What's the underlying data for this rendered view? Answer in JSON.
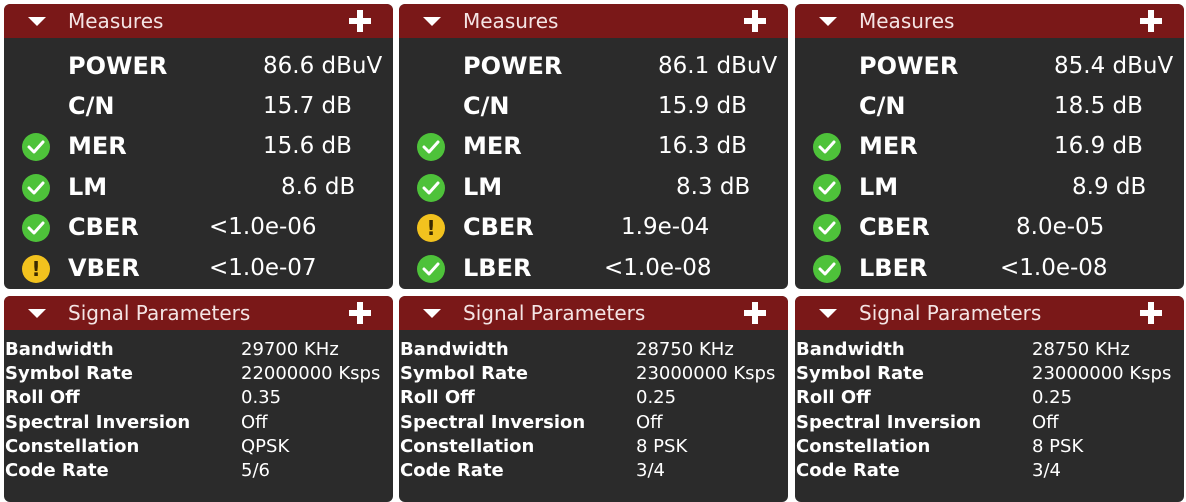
{
  "panels": [
    {
      "measures": {
        "title": "Measures",
        "items": [
          {
            "name": "POWER",
            "value": "86.6 dBuV",
            "status": "none"
          },
          {
            "name": "C/N",
            "value": "15.7 dB",
            "status": "none"
          },
          {
            "name": "MER",
            "value": "15.6 dB",
            "status": "ok"
          },
          {
            "name": "LM",
            "value": "8.6 dB",
            "status": "ok"
          },
          {
            "name": "CBER",
            "value": "<1.0e-06",
            "status": "ok"
          },
          {
            "name": "VBER",
            "value": "<1.0e-07",
            "status": "warning"
          }
        ]
      },
      "signal": {
        "title": "Signal Parameters",
        "items": [
          {
            "name": "Bandwidth",
            "value": "29700 KHz"
          },
          {
            "name": "Symbol Rate",
            "value": "22000000 Ksps"
          },
          {
            "name": "Roll Off",
            "value": "0.35"
          },
          {
            "name": "Spectral Inversion",
            "value": "Off"
          },
          {
            "name": "Constellation",
            "value": "QPSK"
          },
          {
            "name": "Code Rate",
            "value": "5/6"
          }
        ]
      }
    },
    {
      "measures": {
        "title": "Measures",
        "items": [
          {
            "name": "POWER",
            "value": "86.1 dBuV",
            "status": "none"
          },
          {
            "name": "C/N",
            "value": "15.9 dB",
            "status": "none"
          },
          {
            "name": "MER",
            "value": "16.3 dB",
            "status": "ok"
          },
          {
            "name": "LM",
            "value": "8.3 dB",
            "status": "ok"
          },
          {
            "name": "CBER",
            "value": "1.9e-04",
            "status": "warning"
          },
          {
            "name": "LBER",
            "value": "<1.0e-08",
            "status": "ok"
          }
        ]
      },
      "signal": {
        "title": "Signal Parameters",
        "items": [
          {
            "name": "Bandwidth",
            "value": "28750 KHz"
          },
          {
            "name": "Symbol Rate",
            "value": "23000000 Ksps"
          },
          {
            "name": "Roll Off",
            "value": "0.25"
          },
          {
            "name": "Spectral Inversion",
            "value": "Off"
          },
          {
            "name": "Constellation",
            "value": "8 PSK"
          },
          {
            "name": "Code Rate",
            "value": "3/4"
          }
        ]
      }
    },
    {
      "measures": {
        "title": "Measures",
        "items": [
          {
            "name": "POWER",
            "value": "85.4 dBuV",
            "status": "none"
          },
          {
            "name": "C/N",
            "value": "18.5 dB",
            "status": "none"
          },
          {
            "name": "MER",
            "value": "16.9 dB",
            "status": "ok"
          },
          {
            "name": "LM",
            "value": "8.9 dB",
            "status": "ok"
          },
          {
            "name": "CBER",
            "value": "8.0e-05",
            "status": "ok"
          },
          {
            "name": "LBER",
            "value": "<1.0e-08",
            "status": "ok"
          }
        ]
      },
      "signal": {
        "title": "Signal Parameters",
        "items": [
          {
            "name": "Bandwidth",
            "value": "28750 KHz"
          },
          {
            "name": "Symbol Rate",
            "value": "23000000 Ksps"
          },
          {
            "name": "Roll Off",
            "value": "0.25"
          },
          {
            "name": "Spectral Inversion",
            "value": "Off"
          },
          {
            "name": "Constellation",
            "value": "8 PSK"
          },
          {
            "name": "Code Rate",
            "value": "3/4"
          }
        ]
      }
    }
  ],
  "colors": {
    "header": "#7a1818",
    "panel": "#2b2b2b",
    "ok": "#4ec23a",
    "warning": "#f2c21e"
  },
  "icons": {
    "collapse": "caret-down-icon",
    "add": "plus-icon",
    "ok": "check-circle-icon",
    "warning": "exclamation-circle-icon"
  }
}
